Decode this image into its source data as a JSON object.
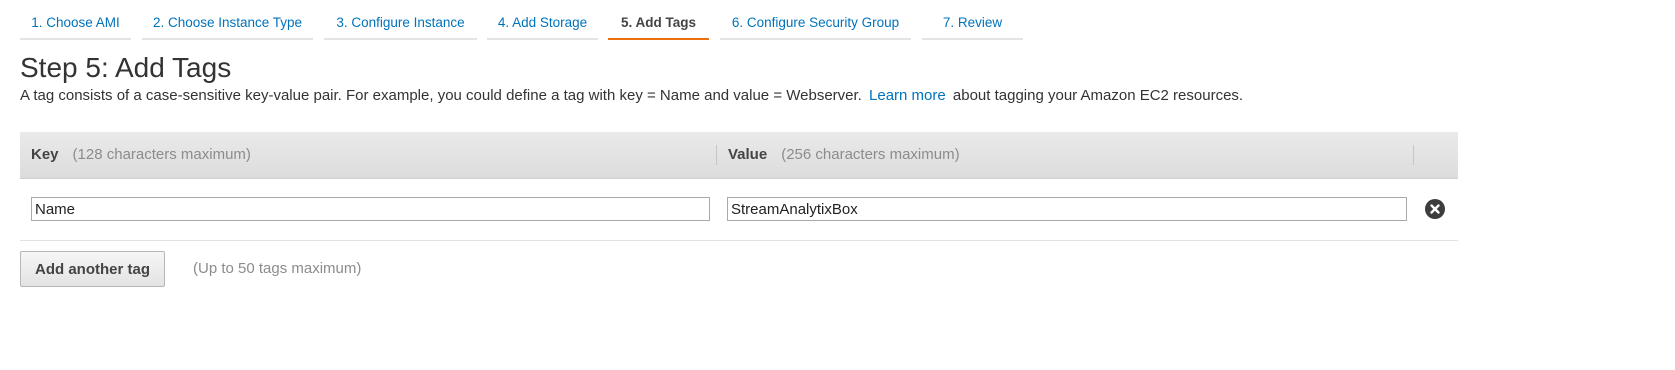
{
  "wizard": {
    "steps": [
      {
        "label": "1. Choose AMI",
        "active": false
      },
      {
        "label": "2. Choose Instance Type",
        "active": false
      },
      {
        "label": "3. Configure Instance",
        "active": false
      },
      {
        "label": "4. Add Storage",
        "active": false
      },
      {
        "label": "5. Add Tags",
        "active": true
      },
      {
        "label": "6. Configure Security Group",
        "active": false
      },
      {
        "label": "7. Review",
        "active": false
      }
    ]
  },
  "page": {
    "title": "Step 5: Add Tags",
    "description_before": "A tag consists of a case-sensitive key-value pair. For example, you could define a tag with key = Name and value = Webserver.",
    "learn_more": "Learn more",
    "description_after": "about tagging your Amazon EC2 resources."
  },
  "table": {
    "key_header": "Key",
    "key_hint": "(128 characters maximum)",
    "value_header": "Value",
    "value_hint": "(256 characters maximum)",
    "rows": [
      {
        "key": "Name",
        "value": "StreamAnalytixBox"
      }
    ]
  },
  "actions": {
    "add_tag_label": "Add another tag",
    "tag_limit_note": "(Up to 50 tags maximum)"
  },
  "colors": {
    "link": "#0073bb",
    "active_tab_accent": "#ec7211"
  },
  "icons": {
    "remove_tag": "close-circle-icon"
  }
}
